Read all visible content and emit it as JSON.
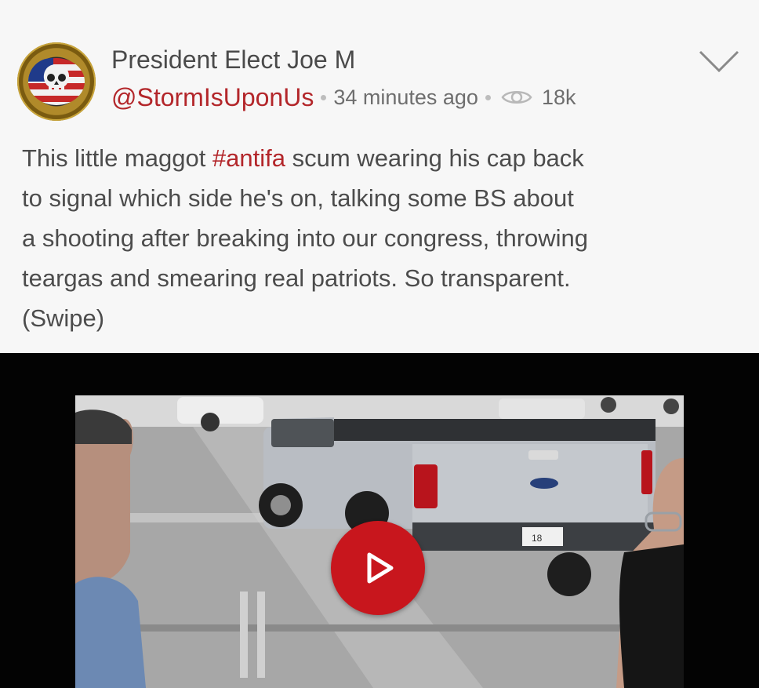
{
  "post": {
    "display_name": "President Elect Joe M",
    "handle": "@StormIsUponUs",
    "time_ago": "34 minutes ago",
    "views": "18k",
    "text_lines": [
      {
        "before": "This little maggot ",
        "hashtag": "#antifa",
        "after": " scum wearing his cap back"
      },
      {
        "text": "to signal which side he's on, talking some BS about"
      },
      {
        "text": "a shooting after breaking into our congress, throwing"
      },
      {
        "text": "teargas and smearing real patriots. So transparent."
      },
      {
        "text": "(Swipe)"
      }
    ]
  },
  "icons": {
    "avatar": "skull-flag-avatar",
    "views": "eye-icon",
    "menu": "chevron-down-icon",
    "play": "play-icon"
  },
  "colors": {
    "accent": "#b3262a",
    "play_button": "#c8161d",
    "card_background": "#f7f7f7",
    "video_background": "#030303"
  },
  "video": {
    "plate": "18"
  }
}
